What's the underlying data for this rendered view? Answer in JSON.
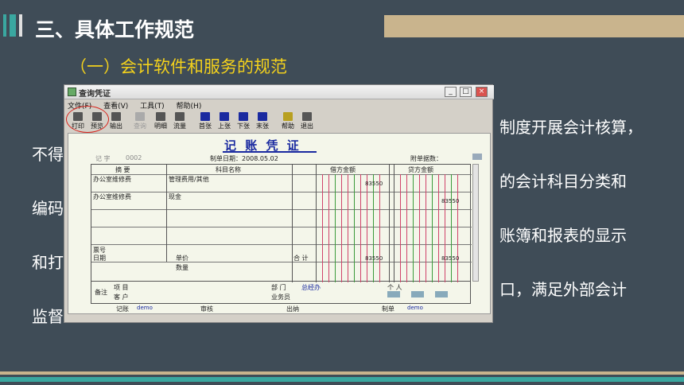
{
  "slide": {
    "title": "三、具体工作规范",
    "subtitle": "（一）会计软件和服务的规范",
    "bg_left": [
      "不得",
      "编码",
      "和打",
      "监督"
    ],
    "bg_right": [
      "制度开展会计核算，",
      "的会计科目分类和",
      "账簿和报表的显示",
      "口，满足外部会计"
    ]
  },
  "window": {
    "title": "查询凭证",
    "menu": [
      "文件(F)",
      "查看(V)",
      "工具(T)",
      "帮助(H)"
    ],
    "toolbar": [
      {
        "label": "打印",
        "icon": "printer-icon",
        "enabled": true
      },
      {
        "label": "预览",
        "icon": "preview-icon",
        "enabled": true
      },
      {
        "label": "输出",
        "icon": "export-icon",
        "enabled": true
      },
      {
        "label": "查询",
        "icon": "binoculars-icon",
        "enabled": false
      },
      {
        "label": "明细",
        "icon": "detail-icon",
        "enabled": true
      },
      {
        "label": "流量",
        "icon": "flow-icon",
        "enabled": true
      },
      {
        "label": "首张",
        "icon": "first-icon",
        "enabled": true
      },
      {
        "label": "上张",
        "icon": "prev-icon",
        "enabled": true
      },
      {
        "label": "下张",
        "icon": "next-icon",
        "enabled": true
      },
      {
        "label": "末张",
        "icon": "last-icon",
        "enabled": true
      },
      {
        "label": "帮助",
        "icon": "help-icon",
        "enabled": true
      },
      {
        "label": "退出",
        "icon": "exit-icon",
        "enabled": true
      }
    ],
    "voucher": {
      "title": "记 账 凭 证",
      "word_label": "记 字",
      "number": "0002",
      "date_label": "制单日期：2008.05.02",
      "attach_label": "附单据数：",
      "headers": {
        "summary": "摘  要",
        "account": "科目名称",
        "debit": "借方金额",
        "credit": "贷方金额"
      },
      "rows": [
        {
          "summary": "办公室维修费",
          "account": "管理费用/其他",
          "debit": "83550",
          "credit": ""
        },
        {
          "summary": "办公室维修费",
          "account": "现金",
          "debit": "",
          "credit": "83550"
        }
      ],
      "bill_no": "票号",
      "date": "日期",
      "unit_price": "单价",
      "quantity": "数量",
      "total_label": "合 计",
      "total_debit": "83550",
      "total_credit": "83550",
      "remark": "备注",
      "project": "项  目",
      "customer": "客  户",
      "dept_label": "部  门",
      "dept_value": "总经办",
      "person_label": "个  人",
      "staff_label": "业务员",
      "bookkeeper": "记账",
      "bookkeeper_name": "demo",
      "auditor": "审核",
      "cashier": "出纳",
      "maker": "制单",
      "maker_name": "demo"
    }
  }
}
